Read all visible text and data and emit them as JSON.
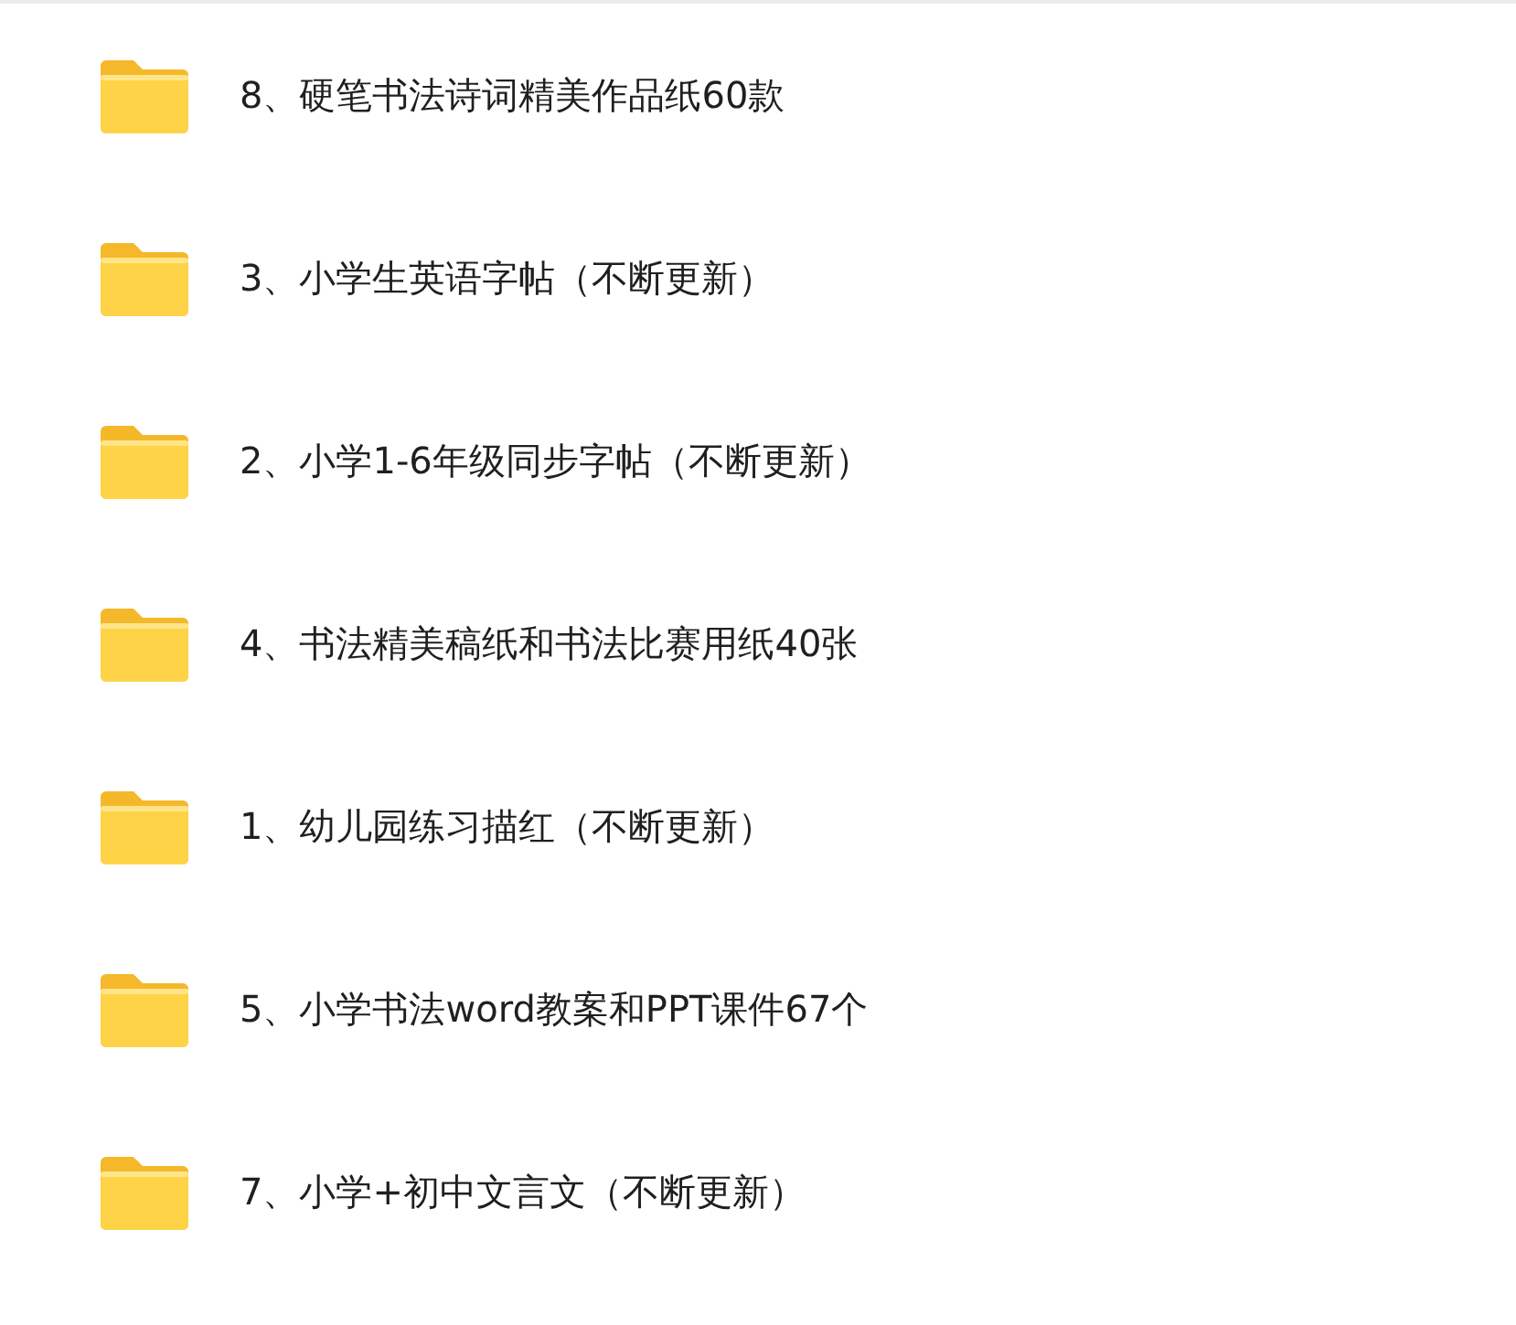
{
  "folders": [
    {
      "name": "8、硬笔书法诗词精美作品纸60款"
    },
    {
      "name": "3、小学生英语字帖（不断更新）"
    },
    {
      "name": "2、小学1-6年级同步字帖（不断更新）"
    },
    {
      "name": "4、书法精美稿纸和书法比赛用纸40张"
    },
    {
      "name": "1、幼儿园练习描红（不断更新）"
    },
    {
      "name": "5、小学书法word教案和PPT课件67个"
    },
    {
      "name": "7、小学+初中文言文（不断更新）"
    }
  ]
}
